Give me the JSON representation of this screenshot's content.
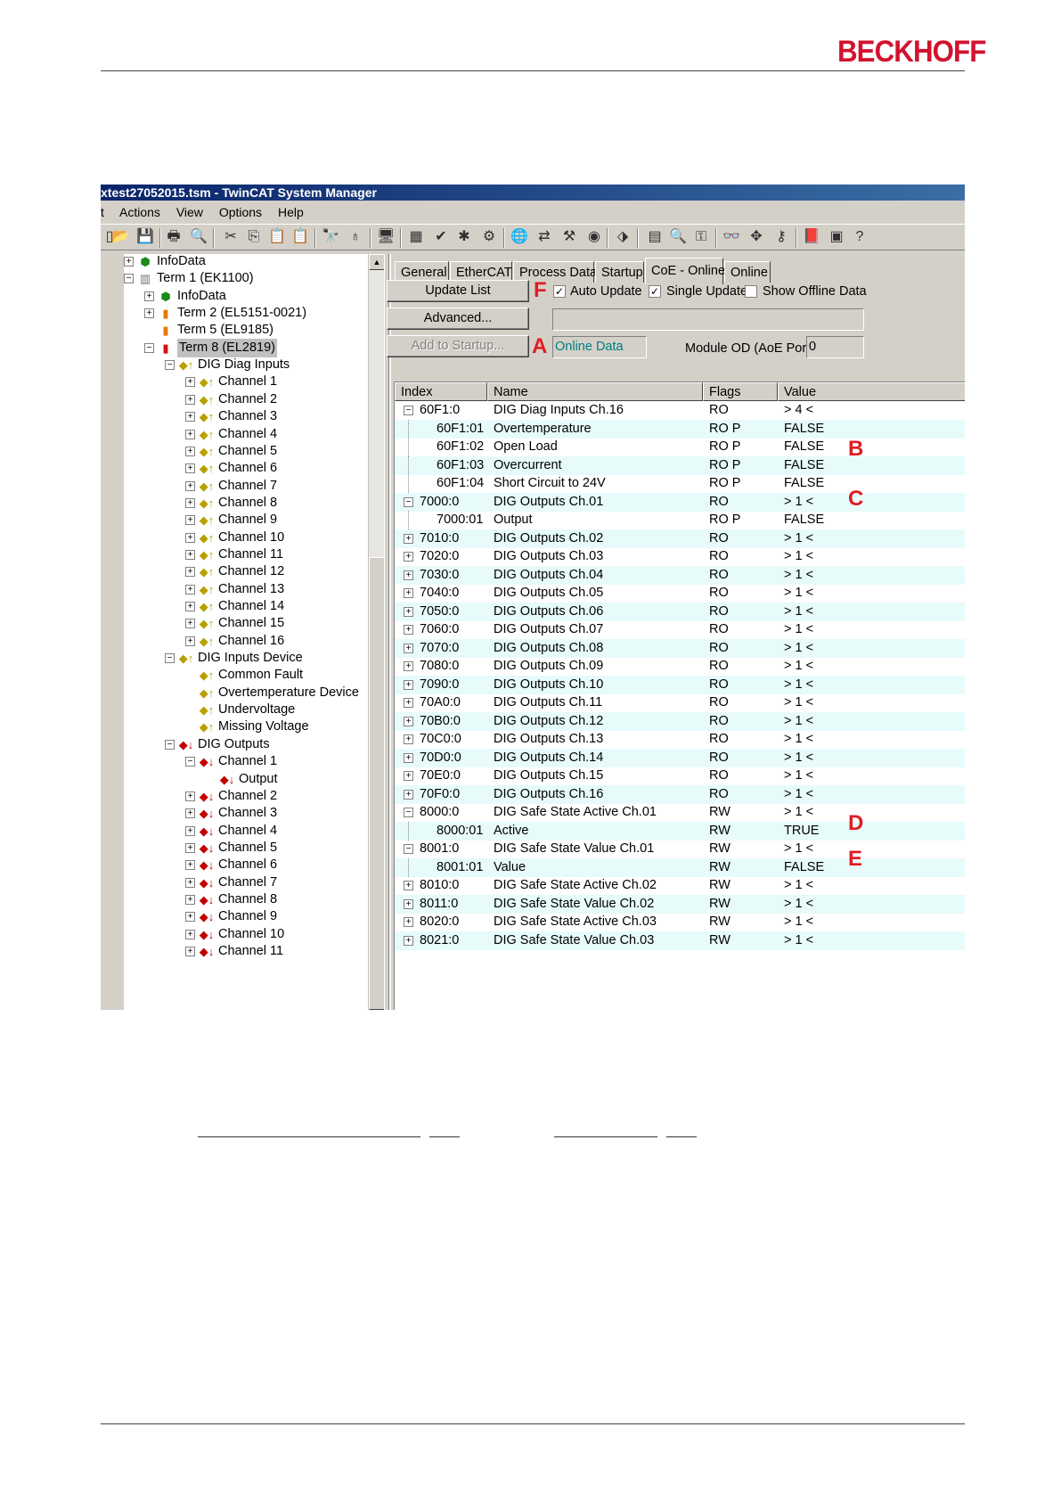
{
  "brand": {
    "logo_text": "BECKHOFF",
    "logo_color": "#d3122e"
  },
  "window": {
    "title": "xtest27052015.tsm - TwinCAT System Manager",
    "menu": [
      "t",
      "Actions",
      "View",
      "Options",
      "Help"
    ]
  },
  "tree": {
    "nodes": [
      {
        "label": "InfoData",
        "icon": "green-gear-icon"
      },
      {
        "label": "Term 1 (EK1100)",
        "icon": "coupler-icon"
      },
      {
        "label": "InfoData",
        "icon": "green-gear-icon"
      },
      {
        "label": "Term 2 (EL5151-0021)",
        "icon": "terminal-orange-icon"
      },
      {
        "label": "Term 5 (EL9185)",
        "icon": "terminal-orange-icon"
      },
      {
        "label": "Term 8 (EL2819)",
        "icon": "terminal-red-icon"
      },
      {
        "label": "DIG Diag Inputs",
        "icon": "input-icon"
      },
      {
        "label": "Channel 1",
        "icon": "input-icon"
      },
      {
        "label": "Channel 2",
        "icon": "input-icon"
      },
      {
        "label": "Channel 3",
        "icon": "input-icon"
      },
      {
        "label": "Channel 4",
        "icon": "input-icon"
      },
      {
        "label": "Channel 5",
        "icon": "input-icon"
      },
      {
        "label": "Channel 6",
        "icon": "input-icon"
      },
      {
        "label": "Channel 7",
        "icon": "input-icon"
      },
      {
        "label": "Channel 8",
        "icon": "input-icon"
      },
      {
        "label": "Channel 9",
        "icon": "input-icon"
      },
      {
        "label": "Channel 10",
        "icon": "input-icon"
      },
      {
        "label": "Channel 11",
        "icon": "input-icon"
      },
      {
        "label": "Channel 12",
        "icon": "input-icon"
      },
      {
        "label": "Channel 13",
        "icon": "input-icon"
      },
      {
        "label": "Channel 14",
        "icon": "input-icon"
      },
      {
        "label": "Channel 15",
        "icon": "input-icon"
      },
      {
        "label": "Channel 16",
        "icon": "input-icon"
      },
      {
        "label": "DIG Inputs Device",
        "icon": "input-icon"
      },
      {
        "label": "Common Fault",
        "icon": "input-icon"
      },
      {
        "label": "Overtemperature Device",
        "icon": "input-icon"
      },
      {
        "label": "Undervoltage",
        "icon": "input-icon"
      },
      {
        "label": "Missing Voltage",
        "icon": "input-icon"
      },
      {
        "label": "DIG Outputs",
        "icon": "output-icon"
      },
      {
        "label": "Channel 1",
        "icon": "output-icon"
      },
      {
        "label": "Output",
        "icon": "output-icon"
      },
      {
        "label": "Channel 2",
        "icon": "output-icon"
      },
      {
        "label": "Channel 3",
        "icon": "output-icon"
      },
      {
        "label": "Channel 4",
        "icon": "output-icon"
      },
      {
        "label": "Channel 5",
        "icon": "output-icon"
      },
      {
        "label": "Channel 6",
        "icon": "output-icon"
      },
      {
        "label": "Channel 7",
        "icon": "output-icon"
      },
      {
        "label": "Channel 8",
        "icon": "output-icon"
      },
      {
        "label": "Channel 9",
        "icon": "output-icon"
      },
      {
        "label": "Channel 10",
        "icon": "output-icon"
      },
      {
        "label": "Channel 11",
        "icon": "output-icon"
      }
    ]
  },
  "tabs": [
    "General",
    "EtherCAT",
    "Process Data",
    "Startup",
    "CoE - Online",
    "Online"
  ],
  "coe": {
    "update_list": "Update List",
    "advanced": "Advanced...",
    "add_to_startup": "Add to Startup...",
    "auto_update": "Auto Update",
    "single_update": "Single Update",
    "show_offline": "Show Offline Data",
    "online_data": "Online Data",
    "module_od_label": "Module OD (AoE Port):",
    "module_od_value": "0",
    "markers": {
      "a": "A",
      "b": "B",
      "c": "C",
      "d": "D",
      "e": "E",
      "f": "F"
    }
  },
  "grid": {
    "columns": [
      "Index",
      "Name",
      "Flags",
      "Value"
    ],
    "rows": [
      {
        "index": "60F1:0",
        "name": "DIG Diag Inputs Ch.16",
        "flags": "RO",
        "value": "> 4 <"
      },
      {
        "index": "60F1:01",
        "name": "Overtemperature",
        "flags": "RO P",
        "value": "FALSE"
      },
      {
        "index": "60F1:02",
        "name": "Open Load",
        "flags": "RO P",
        "value": "FALSE"
      },
      {
        "index": "60F1:03",
        "name": "Overcurrent",
        "flags": "RO P",
        "value": "FALSE"
      },
      {
        "index": "60F1:04",
        "name": "Short Circuit to 24V",
        "flags": "RO P",
        "value": "FALSE"
      },
      {
        "index": "7000:0",
        "name": "DIG Outputs Ch.01",
        "flags": "RO",
        "value": "> 1 <"
      },
      {
        "index": "7000:01",
        "name": "Output",
        "flags": "RO P",
        "value": "FALSE"
      },
      {
        "index": "7010:0",
        "name": "DIG Outputs Ch.02",
        "flags": "RO",
        "value": "> 1 <"
      },
      {
        "index": "7020:0",
        "name": "DIG Outputs Ch.03",
        "flags": "RO",
        "value": "> 1 <"
      },
      {
        "index": "7030:0",
        "name": "DIG Outputs Ch.04",
        "flags": "RO",
        "value": "> 1 <"
      },
      {
        "index": "7040:0",
        "name": "DIG Outputs Ch.05",
        "flags": "RO",
        "value": "> 1 <"
      },
      {
        "index": "7050:0",
        "name": "DIG Outputs Ch.06",
        "flags": "RO",
        "value": "> 1 <"
      },
      {
        "index": "7060:0",
        "name": "DIG Outputs Ch.07",
        "flags": "RO",
        "value": "> 1 <"
      },
      {
        "index": "7070:0",
        "name": "DIG Outputs Ch.08",
        "flags": "RO",
        "value": "> 1 <"
      },
      {
        "index": "7080:0",
        "name": "DIG Outputs Ch.09",
        "flags": "RO",
        "value": "> 1 <"
      },
      {
        "index": "7090:0",
        "name": "DIG Outputs Ch.10",
        "flags": "RO",
        "value": "> 1 <"
      },
      {
        "index": "70A0:0",
        "name": "DIG Outputs Ch.11",
        "flags": "RO",
        "value": "> 1 <"
      },
      {
        "index": "70B0:0",
        "name": "DIG Outputs Ch.12",
        "flags": "RO",
        "value": "> 1 <"
      },
      {
        "index": "70C0:0",
        "name": "DIG Outputs Ch.13",
        "flags": "RO",
        "value": "> 1 <"
      },
      {
        "index": "70D0:0",
        "name": "DIG Outputs Ch.14",
        "flags": "RO",
        "value": "> 1 <"
      },
      {
        "index": "70E0:0",
        "name": "DIG Outputs Ch.15",
        "flags": "RO",
        "value": "> 1 <"
      },
      {
        "index": "70F0:0",
        "name": "DIG Outputs Ch.16",
        "flags": "RO",
        "value": "> 1 <"
      },
      {
        "index": "8000:0",
        "name": "DIG Safe State Active Ch.01",
        "flags": "RW",
        "value": "> 1 <"
      },
      {
        "index": "8000:01",
        "name": "Active",
        "flags": "RW",
        "value": "TRUE"
      },
      {
        "index": "8001:0",
        "name": "DIG Safe State Value Ch.01",
        "flags": "RW",
        "value": "> 1 <"
      },
      {
        "index": "8001:01",
        "name": "Value",
        "flags": "RW",
        "value": "FALSE"
      },
      {
        "index": "8010:0",
        "name": "DIG Safe State Active Ch.02",
        "flags": "RW",
        "value": "> 1 <"
      },
      {
        "index": "8011:0",
        "name": "DIG Safe State Value Ch.02",
        "flags": "RW",
        "value": "> 1 <"
      },
      {
        "index": "8020:0",
        "name": "DIG Safe State Active Ch.03",
        "flags": "RW",
        "value": "> 1 <"
      },
      {
        "index": "8021:0",
        "name": "DIG Safe State Value Ch.03",
        "flags": "RW",
        "value": "> 1 <"
      }
    ]
  }
}
